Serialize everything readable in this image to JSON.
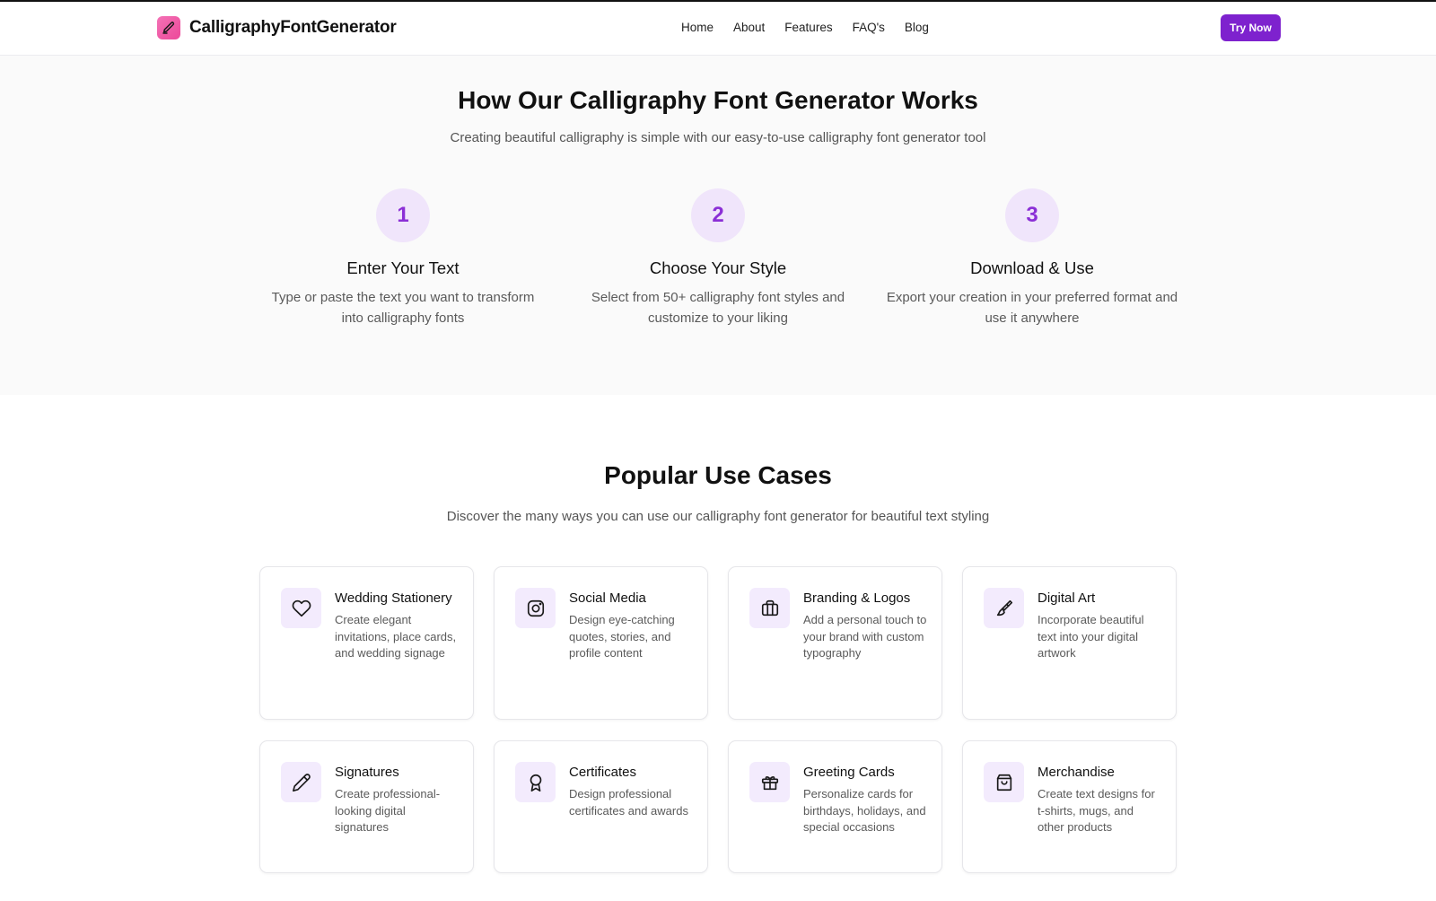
{
  "header": {
    "brand": "CalligraphyFontGenerator",
    "nav": [
      "Home",
      "About",
      "Features",
      "FAQ's",
      "Blog"
    ],
    "cta": "Try Now"
  },
  "colors": {
    "accent": "#7e22ce",
    "accent_soft": "#f0e5fb",
    "logo": "#ec4899"
  },
  "how": {
    "title": "How Our Calligraphy Font Generator Works",
    "subtitle": "Creating beautiful calligraphy is simple with our easy-to-use calligraphy font generator tool",
    "steps": [
      {
        "num": "1",
        "title": "Enter Your Text",
        "desc": "Type or paste the text you want to transform into calligraphy fonts"
      },
      {
        "num": "2",
        "title": "Choose Your Style",
        "desc": "Select from 50+ calligraphy font styles and customize to your liking"
      },
      {
        "num": "3",
        "title": "Download & Use",
        "desc": "Export your creation in your preferred format and use it anywhere"
      }
    ]
  },
  "uses": {
    "title": "Popular Use Cases",
    "subtitle": "Discover the many ways you can use our calligraphy font generator for beautiful text styling",
    "cards": [
      {
        "icon": "heart-icon",
        "title": "Wedding Stationery",
        "desc": "Create elegant invitations, place cards, and wedding signage"
      },
      {
        "icon": "instagram-icon",
        "title": "Social Media",
        "desc": "Design eye-catching quotes, stories, and profile content"
      },
      {
        "icon": "briefcase-icon",
        "title": "Branding & Logos",
        "desc": "Add a personal touch to your brand with custom typography"
      },
      {
        "icon": "paintbrush-icon",
        "title": "Digital Art",
        "desc": "Incorporate beautiful text into your digital artwork"
      },
      {
        "icon": "pencil-icon",
        "title": "Signatures",
        "desc": "Create professional-looking digital signatures"
      },
      {
        "icon": "award-icon",
        "title": "Certificates",
        "desc": "Design professional certificates and awards"
      },
      {
        "icon": "gift-icon",
        "title": "Greeting Cards",
        "desc": "Personalize cards for birthdays, holidays, and special occasions"
      },
      {
        "icon": "shopping-bag-icon",
        "title": "Merchandise",
        "desc": "Create text designs for t-shirts, mugs, and other products"
      }
    ]
  }
}
